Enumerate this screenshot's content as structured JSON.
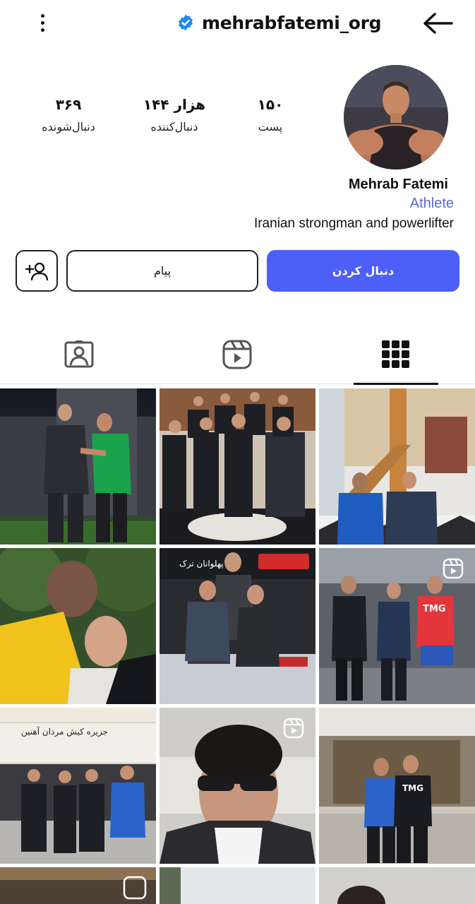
{
  "header": {
    "username": "mehrabfatemi_org",
    "verified_color": "#1f8bf0",
    "icons": [
      "more-vertical-icon",
      "verified-badge-icon",
      "back-arrow-icon"
    ]
  },
  "profile": {
    "name": "Mehrab Fatemi",
    "category": "Athlete",
    "bio": "Iranian strongman and powerlifter"
  },
  "stats": {
    "posts": {
      "value": "۱۵۰",
      "label": "پست"
    },
    "followers": {
      "value": "۱۴۴ هزار",
      "label": "دنبال‌کننده"
    },
    "following": {
      "value": "۳۶۹",
      "label": "دنبال‌شونده"
    }
  },
  "actions": {
    "follow_label": "دنبال کردن",
    "message_label": "پیام",
    "follow_color": "#4c5ff6"
  },
  "tabs": [
    {
      "name": "tagged",
      "icon": "tagged-person-icon"
    },
    {
      "name": "reels",
      "icon": "reels-icon"
    },
    {
      "name": "grid",
      "icon": "grid-icon",
      "active": true
    }
  ],
  "posts": [
    {
      "id": "post-1",
      "reel": false,
      "banner": ""
    },
    {
      "id": "post-2",
      "reel": false,
      "banner": ""
    },
    {
      "id": "post-3",
      "reel": false,
      "banner": ""
    },
    {
      "id": "post-4",
      "reel": false,
      "banner": ""
    },
    {
      "id": "post-5",
      "reel": false,
      "banner": "پهلوانان ترک"
    },
    {
      "id": "post-6",
      "reel": true,
      "banner": "TMG"
    },
    {
      "id": "post-7",
      "reel": false,
      "banner": "جزیره کیش مردان آهنین"
    },
    {
      "id": "post-8",
      "reel": true,
      "banner": ""
    },
    {
      "id": "post-9",
      "reel": false,
      "banner": "TMG"
    },
    {
      "id": "post-10",
      "reel": false,
      "banner": ""
    },
    {
      "id": "post-11",
      "reel": false,
      "banner": ""
    },
    {
      "id": "post-12",
      "reel": false,
      "banner": ""
    }
  ]
}
